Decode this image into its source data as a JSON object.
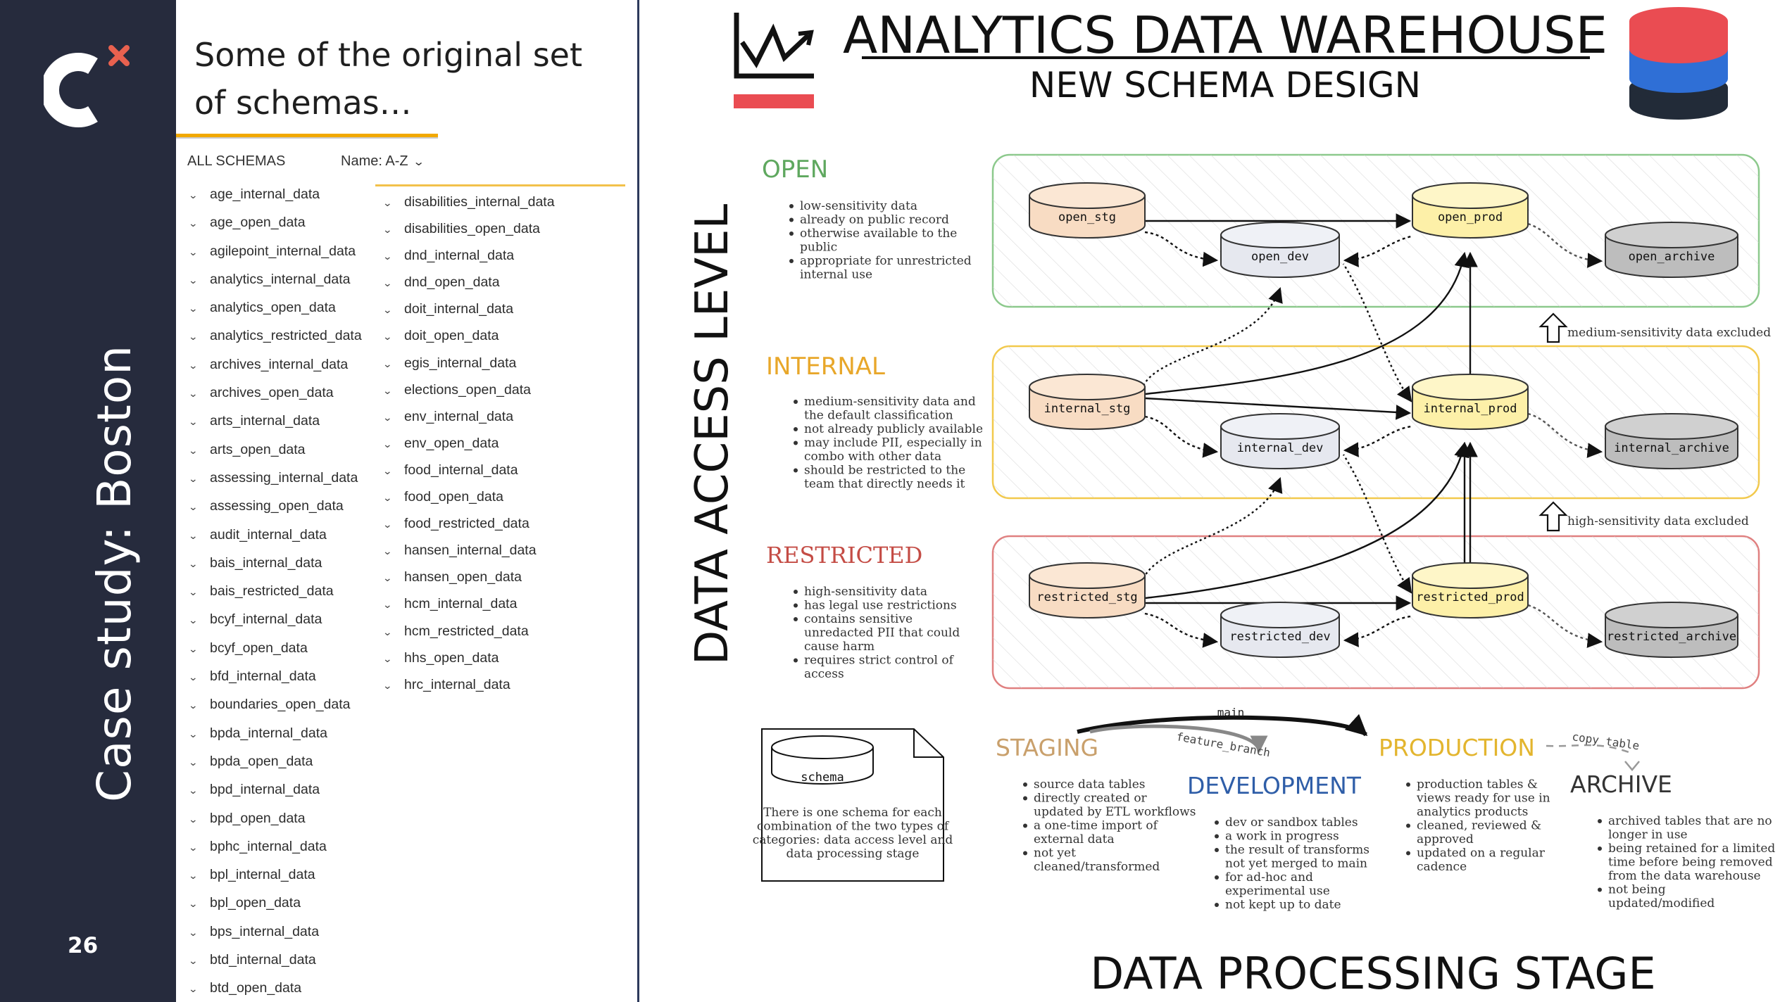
{
  "slide": {
    "page_number": "26",
    "side_title": "Case study: Boston",
    "colors": {
      "rail": "#262b3d",
      "accent_yellow": "#f2a900",
      "logo_x": "#e8614f"
    }
  },
  "schema_panel": {
    "title": "Some of the original set of schemas…",
    "header_label": "ALL SCHEMAS",
    "sort_label": "Name: A-Z",
    "column1": [
      "age_internal_data",
      "age_open_data",
      "agilepoint_internal_data",
      "analytics_internal_data",
      "analytics_open_data",
      "analytics_restricted_data",
      "archives_internal_data",
      "archives_open_data",
      "arts_internal_data",
      "arts_open_data",
      "assessing_internal_data",
      "assessing_open_data",
      "audit_internal_data",
      "bais_internal_data",
      "bais_restricted_data",
      "bcyf_internal_data",
      "bcyf_open_data",
      "bfd_internal_data",
      "boundaries_open_data",
      "bpda_internal_data",
      "bpda_open_data",
      "bpd_internal_data",
      "bpd_open_data",
      "bphc_internal_data",
      "bpl_internal_data",
      "bpl_open_data",
      "bps_internal_data",
      "btd_internal_data",
      "btd_open_data"
    ],
    "column2": [
      "disabilities_internal_data",
      "disabilities_open_data",
      "dnd_internal_data",
      "dnd_open_data",
      "doit_internal_data",
      "doit_open_data",
      "egis_internal_data",
      "elections_open_data",
      "env_internal_data",
      "env_open_data",
      "food_internal_data",
      "food_open_data",
      "food_restricted_data",
      "hansen_internal_data",
      "hansen_open_data",
      "hcm_internal_data",
      "hcm_restricted_data",
      "hhs_open_data",
      "hrc_internal_data"
    ]
  },
  "diagram": {
    "title": "ANALYTICS DATA WAREHOUSE",
    "subtitle": "NEW SCHEMA DESIGN",
    "y_axis_label": "DATA ACCESS LEVEL",
    "x_axis_label": "DATA PROCESSING STAGE",
    "levels": {
      "open": {
        "name": "OPEN",
        "bullets": [
          "low-sensitivity data",
          "already on public record",
          "otherwise available to the",
          "public",
          "appropriate for unrestricted",
          "internal use"
        ],
        "nodes": {
          "stg": "open_stg",
          "dev": "open_dev",
          "prod": "open_prod",
          "archive": "open_archive"
        }
      },
      "internal": {
        "name": "INTERNAL",
        "bullets": [
          "medium-sensitivity data and",
          "the default classification",
          "not already publicly available",
          "may include PII, especially in",
          "combo with other data",
          "should be restricted to the",
          "team that directly needs it"
        ],
        "nodes": {
          "stg": "internal_stg",
          "dev": "internal_dev",
          "prod": "internal_prod",
          "archive": "internal_archive"
        }
      },
      "restricted": {
        "name": "RESTRICTED",
        "bullets": [
          "high-sensitivity data",
          "has legal use restrictions",
          "contains sensitive",
          "unredacted PII that could",
          "cause harm",
          "requires strict control of",
          "access"
        ],
        "nodes": {
          "stg": "restricted_stg",
          "dev": "restricted_dev",
          "prod": "restricted_prod",
          "archive": "restricted_archive"
        }
      }
    },
    "exclusions": [
      "medium-sensitivity data excluded",
      "high-sensitivity data excluded"
    ],
    "legend": {
      "node_label": "schema",
      "text": [
        "There is one schema for each",
        "combination of the two types of",
        "categories: data access level and",
        "data processing stage"
      ]
    },
    "flow_labels": {
      "main": "main",
      "feature_branch": "feature_branch",
      "copy_table": "copy table"
    },
    "stages": {
      "staging": {
        "name": "STAGING",
        "bullets": [
          "source data tables",
          "directly created or",
          "updated by ETL workflows",
          "a one-time import of",
          "external data",
          "not yet",
          "cleaned/transformed"
        ]
      },
      "development": {
        "name": "DEVELOPMENT",
        "bullets": [
          "dev or sandbox tables",
          "a work in progress",
          "the result of transforms",
          "not yet merged to main",
          "for ad-hoc and",
          "experimental use",
          "not kept up to date"
        ]
      },
      "production": {
        "name": "PRODUCTION",
        "bullets": [
          "production tables &",
          "views ready for use in",
          "analytics products",
          "cleaned, reviewed &",
          "approved",
          "updated on a regular",
          "cadence"
        ]
      },
      "archive": {
        "name": "ARCHIVE",
        "bullets": [
          "archived tables that are no",
          "longer in use",
          "being retained for a limited",
          "time before being removed",
          "from the data warehouse",
          "not being",
          "updated/modified"
        ]
      }
    }
  }
}
